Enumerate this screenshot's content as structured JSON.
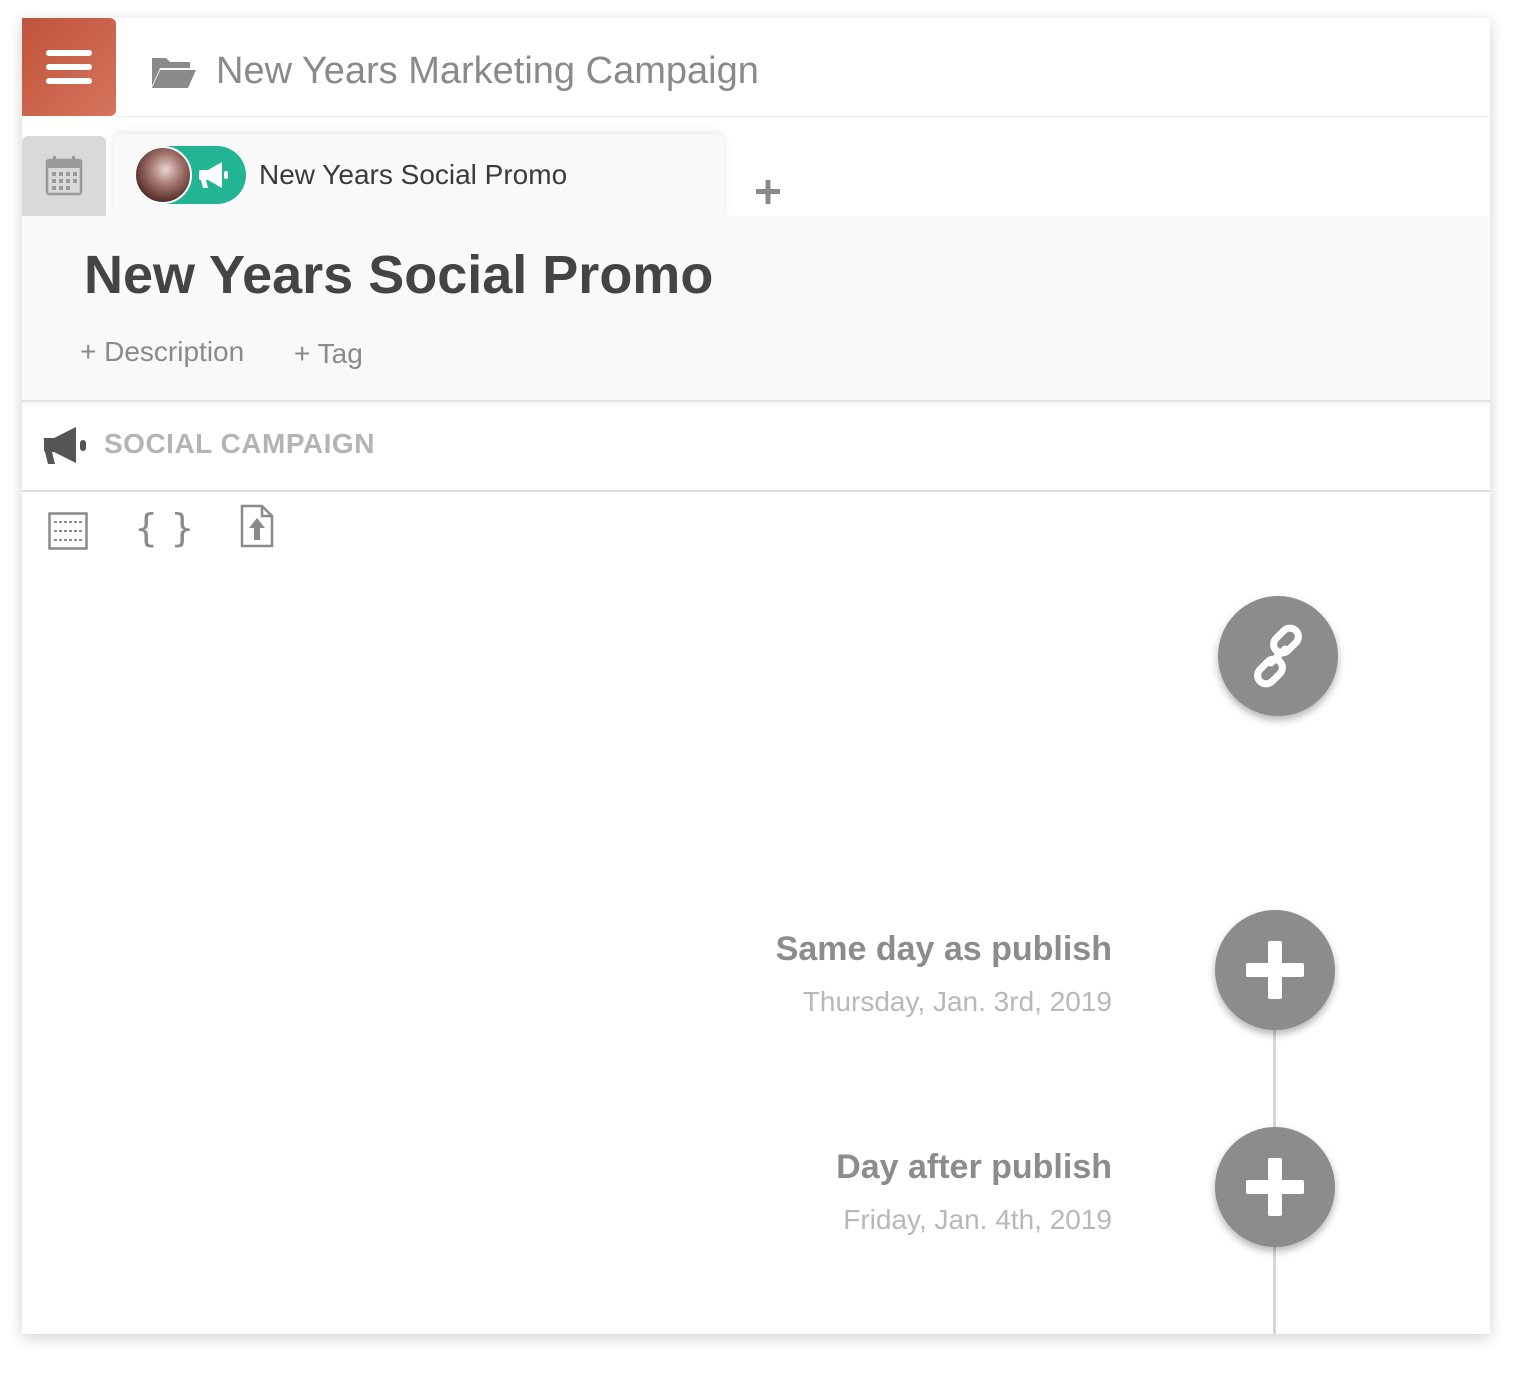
{
  "header": {
    "menu_icon": "hamburger-menu-icon",
    "folder_icon": "folder-open-icon",
    "campaign_title": "New Years Marketing Campaign",
    "accent_color": "#c9614a"
  },
  "tabs": {
    "calendar_icon": "calendar-icon",
    "active": {
      "label": "New Years Social Promo",
      "pill_color": "#22b493",
      "pill_icon": "megaphone-icon"
    },
    "add_icon": "plus-icon"
  },
  "document": {
    "title": "New Years Social Promo",
    "add_description": "+ Description",
    "add_tag": "+ Tag"
  },
  "section": {
    "icon": "megaphone-icon",
    "label": "SOCIAL CAMPAIGN"
  },
  "toolbar": {
    "tools": [
      "layout-grid-icon",
      "braces-icon",
      "file-upload-icon"
    ],
    "braces_text": "{ }"
  },
  "timeline": {
    "link_button_icon": "link-icon",
    "events": [
      {
        "title": "Same day as publish",
        "date": "Thursday, Jan. 3rd, 2019",
        "button_icon": "plus-icon"
      },
      {
        "title": "Day after publish",
        "date": "Friday, Jan. 4th, 2019",
        "button_icon": "plus-icon"
      }
    ],
    "circle_color": "#8c8c8c"
  }
}
